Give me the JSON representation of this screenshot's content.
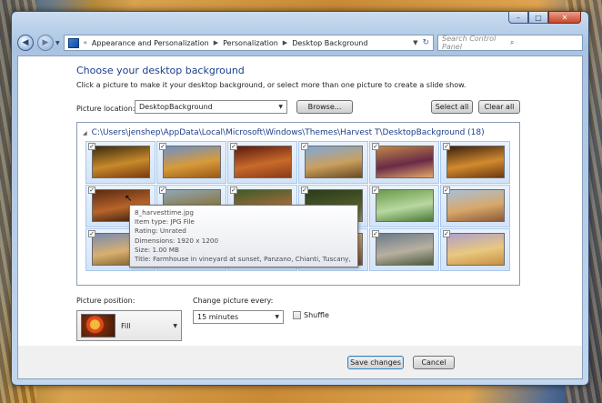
{
  "window": {
    "caption_buttons": {
      "minimize": "–",
      "maximize": "□",
      "close": "✕"
    }
  },
  "nav": {
    "back_icon": "back-arrow-icon",
    "forward_icon": "forward-arrow-icon",
    "breadcrumb": [
      "Appearance and Personalization",
      "Personalization",
      "Desktop Background"
    ],
    "search_placeholder": "Search Control Panel"
  },
  "page": {
    "title": "Choose your desktop background",
    "subtitle": "Click a picture to make it your desktop background, or select more than one picture to create a slide show.",
    "location_label": "Picture location:",
    "location_value": "DesktopBackground",
    "browse_label": "Browse...",
    "select_all_label": "Select all",
    "clear_all_label": "Clear all",
    "gallery_path": "C:\\Users\\jenshep\\AppData\\Local\\Microsoft\\Windows\\Themes\\Harvest T\\DesktopBackground (18)",
    "position_label": "Picture position:",
    "position_value": "Fill",
    "change_label": "Change picture every:",
    "change_value": "15 minutes",
    "shuffle_label": "Shuffle",
    "shuffle_checked": false
  },
  "thumbnails": [
    {
      "checked": true,
      "colors": [
        "#3a2a12",
        "#c78a2a",
        "#7a3a10"
      ]
    },
    {
      "checked": true,
      "colors": [
        "#6b8fc9",
        "#d79b3a",
        "#9b5a18"
      ]
    },
    {
      "checked": true,
      "colors": [
        "#5a1a10",
        "#c86a2a",
        "#8a3a18"
      ]
    },
    {
      "checked": true,
      "colors": [
        "#7fa8d9",
        "#caa060",
        "#6a4a20"
      ]
    },
    {
      "checked": true,
      "colors": [
        "#c08848",
        "#6a2a48",
        "#e2a868"
      ]
    },
    {
      "checked": true,
      "colors": [
        "#3a2010",
        "#d28a2e",
        "#6a3a12"
      ]
    },
    {
      "checked": true,
      "colors": [
        "#5a2a12",
        "#b8642a",
        "#2e1a0c"
      ]
    },
    {
      "checked": true,
      "colors": [
        "#8fa8b8",
        "#8a7a4a",
        "#5a4a2a"
      ]
    },
    {
      "checked": true,
      "colors": [
        "#3e5a28",
        "#9a6a3a",
        "#c8a86a"
      ]
    },
    {
      "checked": true,
      "colors": [
        "#2a3a1a",
        "#4e5a2a",
        "#8a8a5a"
      ]
    },
    {
      "checked": true,
      "colors": [
        "#6a9a4a",
        "#b8d8a0",
        "#4a7a3a"
      ]
    },
    {
      "checked": true,
      "colors": [
        "#a8c0d8",
        "#d8a86a",
        "#8a5a3a"
      ]
    },
    {
      "checked": true,
      "colors": [
        "#7a8ab0",
        "#d8b070",
        "#7a5a2a"
      ]
    },
    {
      "checked": true,
      "colors": [
        "#c8d0c0",
        "#e0d8b0",
        "#a8a080"
      ]
    },
    {
      "checked": true,
      "colors": [
        "#d0c8a0",
        "#b8a070",
        "#8a7a50"
      ]
    },
    {
      "checked": true,
      "colors": [
        "#d0b080",
        "#a88050",
        "#6a5030"
      ]
    },
    {
      "checked": true,
      "colors": [
        "#6a7a8a",
        "#b8b0a0",
        "#4a5a3a"
      ]
    },
    {
      "checked": true,
      "colors": [
        "#b0a0c8",
        "#e8c880",
        "#c89040"
      ]
    }
  ],
  "tooltip": {
    "name": "8_harvesttime.jpg",
    "type": "Item type: JPG File",
    "rating": "Rating: Unrated",
    "dimensions": "Dimensions: 1920 x 1200",
    "size": "Size: 1.00 MB",
    "title": "Title: Farmhouse in  vineyard at sunset, Panzano, Chianti, Tuscany, Italy"
  },
  "footer": {
    "save_label": "Save changes",
    "cancel_label": "Cancel"
  }
}
